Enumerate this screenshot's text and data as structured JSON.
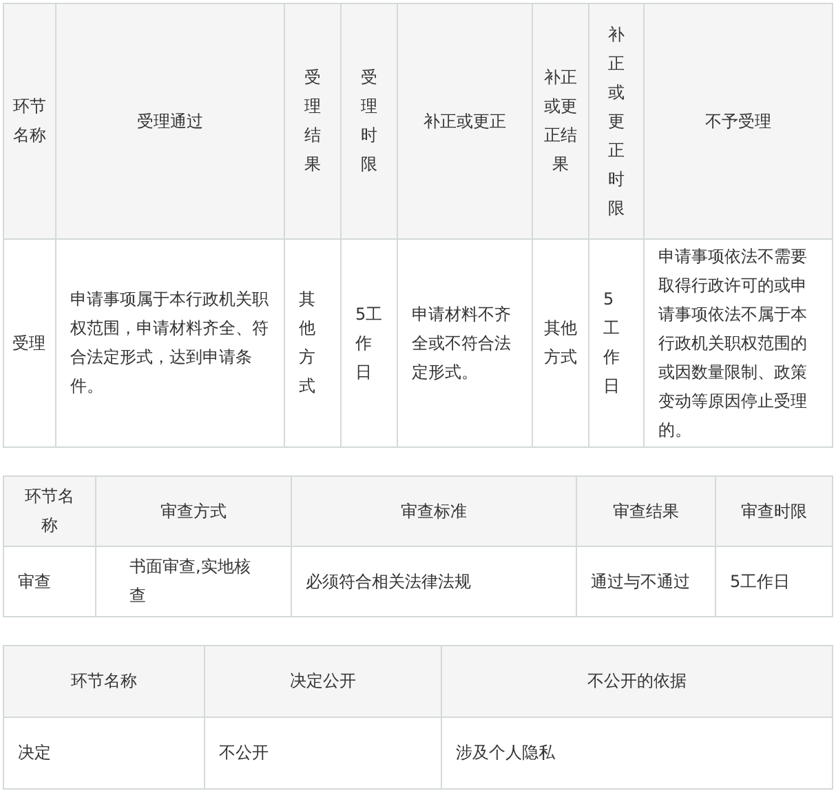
{
  "tables": [
    {
      "columns": [
        "环节名称",
        "受理通过",
        "受理结果",
        "受理时限",
        "补正或更正",
        "补正或更正结果",
        "补正或更正时限",
        "不予受理"
      ],
      "rows": [
        [
          "受理",
          "申请事项属于本行政机关职权范围，申请材料齐全、符合法定形式，达到申请条件。",
          "其他方式",
          "5工作日",
          "申请材料不齐全或不符合法定形式。",
          "其他方式",
          "5工作日",
          "申请事项依法不需要取得行政许可的或申请事项依法不属于本行政机关职权范围的或因数量限制、政策变动等原因停止受理的。"
        ]
      ]
    },
    {
      "columns": [
        "环节名称",
        "审查方式",
        "审查标准",
        "审查结果",
        "审查时限"
      ],
      "rows": [
        [
          "审查",
          "书面审查,实地核查",
          "必须符合相关法律法规",
          "通过与不通过",
          "5工作日"
        ]
      ]
    },
    {
      "columns": [
        "环节名称",
        "决定公开",
        "不公开的依据"
      ],
      "rows": [
        [
          "决定",
          "不公开",
          "涉及个人隐私"
        ]
      ]
    }
  ]
}
